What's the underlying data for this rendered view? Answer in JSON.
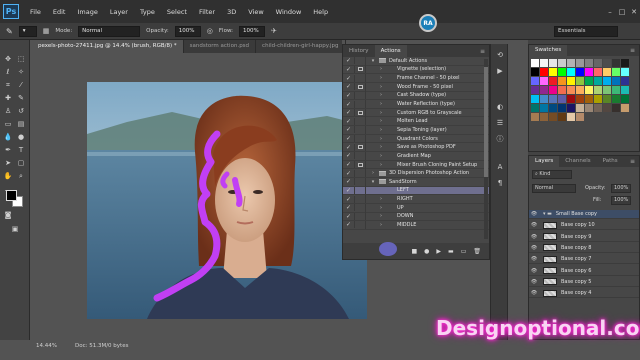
{
  "menubar": {
    "logo": "Ps",
    "items": [
      "File",
      "Edit",
      "Image",
      "Layer",
      "Type",
      "Select",
      "Filter",
      "3D",
      "View",
      "Window",
      "Help"
    ]
  },
  "options": {
    "mode_label": "Mode:",
    "mode_value": "Normal",
    "opacity_label": "Opacity:",
    "opacity_value": "100%",
    "flow_label": "Flow:",
    "flow_value": "100%",
    "workspace": "Essentials"
  },
  "badge": "RA",
  "tabs": [
    "pexels-photo-27411.jpg @ 14.4% (brush, RGB/8) *",
    "sandstorm action.psd",
    "child-children-girl-happy.jpg"
  ],
  "status": {
    "zoom": "14.44%",
    "doc": "Doc: 51.3M/0 bytes"
  },
  "actions": {
    "tabs": [
      "History",
      "Actions"
    ],
    "rows": [
      {
        "label": "Default Actions",
        "check": "✓",
        "dialog": false,
        "tri": "▾",
        "indent": 0
      },
      {
        "label": "Vignette (selection)",
        "check": "✓",
        "dialog": true,
        "tri": "›",
        "indent": 1
      },
      {
        "label": "Frame Channel - 50 pixel",
        "check": "✓",
        "dialog": false,
        "tri": "›",
        "indent": 1
      },
      {
        "label": "Wood Frame - 50 pixel",
        "check": "✓",
        "dialog": true,
        "tri": "›",
        "indent": 1
      },
      {
        "label": "Cast Shadow (type)",
        "check": "✓",
        "dialog": false,
        "tri": "›",
        "indent": 1
      },
      {
        "label": "Water Reflection (type)",
        "check": "✓",
        "dialog": false,
        "tri": "›",
        "indent": 1
      },
      {
        "label": "Custom RGB to Grayscale",
        "check": "✓",
        "dialog": true,
        "tri": "›",
        "indent": 1
      },
      {
        "label": "Molten Lead",
        "check": "✓",
        "dialog": false,
        "tri": "›",
        "indent": 1
      },
      {
        "label": "Sepia Toning (layer)",
        "check": "✓",
        "dialog": false,
        "tri": "›",
        "indent": 1
      },
      {
        "label": "Quadrant Colors",
        "check": "✓",
        "dialog": false,
        "tri": "›",
        "indent": 1
      },
      {
        "label": "Save as Photoshop PDF",
        "check": "✓",
        "dialog": true,
        "tri": "›",
        "indent": 1
      },
      {
        "label": "Gradient Map",
        "check": "✓",
        "dialog": false,
        "tri": "›",
        "indent": 1
      },
      {
        "label": "Mixer Brush Cloning Paint Setup",
        "check": "✓",
        "dialog": true,
        "tri": "›",
        "indent": 1
      },
      {
        "label": "3D Dispersion Photoshop Action",
        "check": "✓",
        "dialog": false,
        "tri": "›",
        "indent": 0
      },
      {
        "label": "SandStorm",
        "check": "✓",
        "dialog": false,
        "tri": "▾",
        "indent": 0
      },
      {
        "label": "LEFT",
        "check": "✓",
        "dialog": false,
        "tri": "",
        "indent": 1,
        "highlight": true
      },
      {
        "label": "RIGHT",
        "check": "✓",
        "dialog": false,
        "tri": "›",
        "indent": 1
      },
      {
        "label": "UP",
        "check": "✓",
        "dialog": false,
        "tri": "›",
        "indent": 1
      },
      {
        "label": "DOWN",
        "check": "✓",
        "dialog": false,
        "tri": "›",
        "indent": 1
      },
      {
        "label": "MIDDLE",
        "check": "✓",
        "dialog": false,
        "tri": "›",
        "indent": 1
      }
    ],
    "footer_icons": [
      "■",
      "●",
      "▶",
      "▬",
      "▭",
      "🗑"
    ]
  },
  "swatches": {
    "tab": "Swatches",
    "colors": [
      "#ffffff",
      "#f5f5f5",
      "#e6e6e6",
      "#cccccc",
      "#b3b3b3",
      "#999999",
      "#808080",
      "#666666",
      "#4d4d4d",
      "#333333",
      "#1a1a1a",
      "#000000",
      "#ff0000",
      "#ffff00",
      "#00ff00",
      "#00ffff",
      "#0000ff",
      "#ff00ff",
      "#ff6666",
      "#ffcc66",
      "#66ff66",
      "#66ffff",
      "#6666ff",
      "#ff66ff",
      "#ed1c24",
      "#f7941d",
      "#fff200",
      "#8dc63f",
      "#00a651",
      "#00a99d",
      "#00aeef",
      "#0072bc",
      "#2e3192",
      "#662d91",
      "#92278f",
      "#ec008c",
      "#f26c4f",
      "#f68e56",
      "#fbaf5d",
      "#fff568",
      "#acd373",
      "#7cc576",
      "#3cb878",
      "#1cbbb4",
      "#00bff3",
      "#448ccb",
      "#5674b9",
      "#605ca8",
      "#9e0b0f",
      "#a0410d",
      "#a3620a",
      "#aba000",
      "#598527",
      "#1a7b30",
      "#007236",
      "#00746b",
      "#0076a3",
      "#004a80",
      "#003471",
      "#1b1464",
      "#c7b299",
      "#998675",
      "#736357",
      "#534741",
      "#37302d",
      "#c69c6d",
      "#a67c52",
      "#8c6239",
      "#754c24",
      "#603913",
      "#e5c9a8",
      "#b48a6a"
    ]
  },
  "layers": {
    "tabs": [
      "Layers",
      "Channels",
      "Paths"
    ],
    "kind": "Kind",
    "blend": "Normal",
    "opacity_label": "Opacity:",
    "opacity_value": "100%",
    "fill_label": "Fill:",
    "fill_value": "100%",
    "rows": [
      {
        "label": "Small Base copy",
        "group": true
      },
      {
        "label": "Base copy 10",
        "group": false
      },
      {
        "label": "Base copy 9",
        "group": false
      },
      {
        "label": "Base copy 8",
        "group": false
      },
      {
        "label": "Base copy 7",
        "group": false
      },
      {
        "label": "Base copy 6",
        "group": false
      },
      {
        "label": "Base copy 5",
        "group": false
      },
      {
        "label": "Base copy 4",
        "group": false
      }
    ]
  },
  "watermark": "Designoptional.com"
}
